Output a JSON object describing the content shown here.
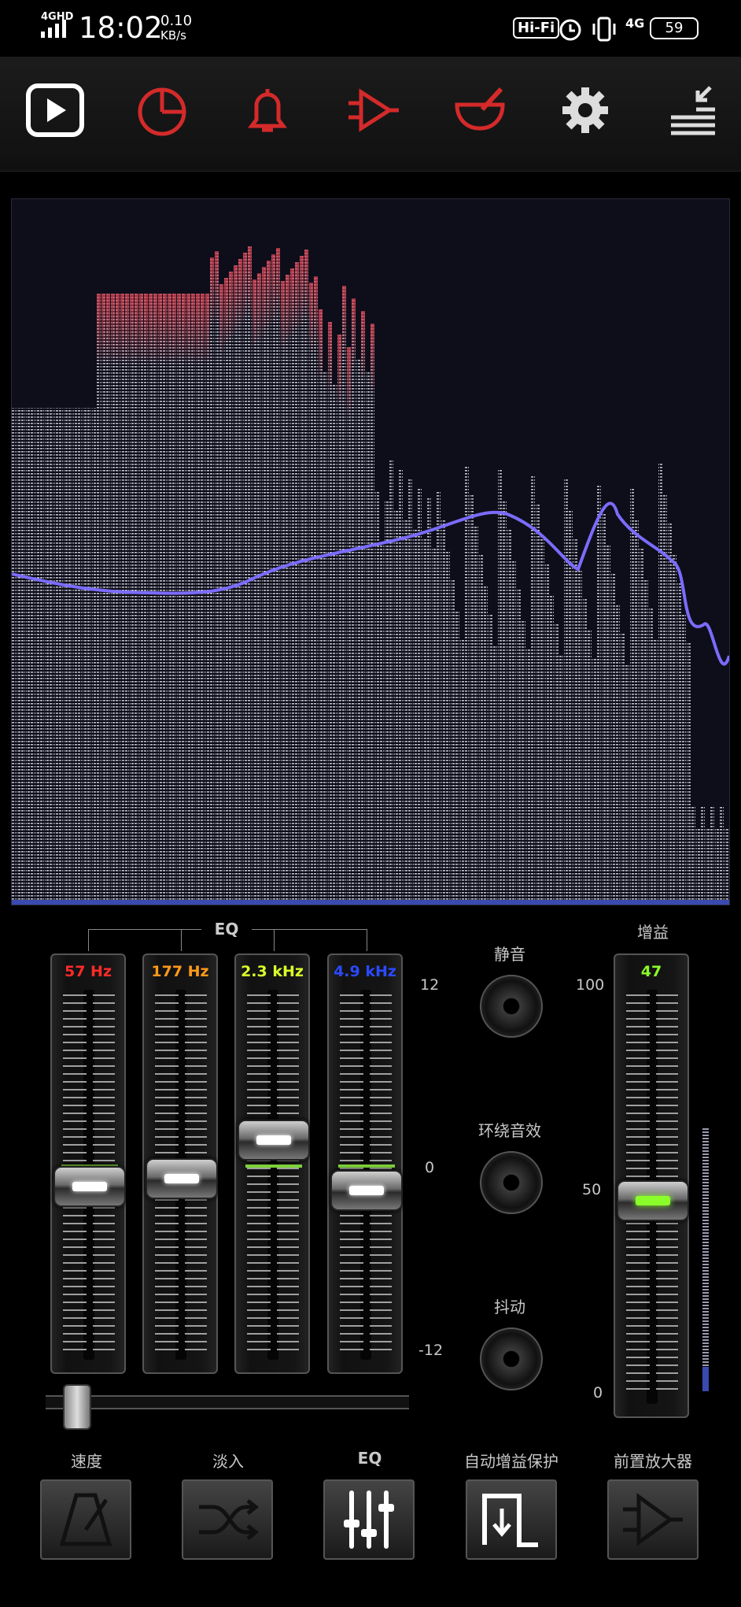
{
  "status": {
    "network_type": "4GHD",
    "time": "18:02",
    "speed_value": "0.10",
    "speed_unit": "KB/s",
    "hifi": "Hi-Fi",
    "cell": "4G",
    "battery": "59"
  },
  "toolbar": {
    "icons": [
      "play-icon",
      "pie-chart-icon",
      "bell-icon",
      "amplifier-icon",
      "mortar-icon",
      "gear-icon",
      "collapse-menu-icon"
    ]
  },
  "eq": {
    "header": "EQ",
    "bands": [
      {
        "freq": "57 Hz",
        "color": "#ff2a2a",
        "gain_db": -1.5
      },
      {
        "freq": "177 Hz",
        "color": "#ff9a1a",
        "gain_db": -1.0
      },
      {
        "freq": "2.3 kHz",
        "color": "#d8ff2a",
        "gain_db": 1.7
      },
      {
        "freq": "4.9 kHz",
        "color": "#2a4aff",
        "gain_db": -1.8
      }
    ],
    "scale_top": "12",
    "scale_mid": "0",
    "scale_bottom": "-12"
  },
  "toggles": {
    "mute": "静音",
    "surround": "环绕音效",
    "dither": "抖动"
  },
  "gain": {
    "label": "增益",
    "value": "47",
    "scale_top": "100",
    "scale_mid": "50",
    "scale_bottom": "0"
  },
  "bottom": {
    "tempo": "速度",
    "fade": "淡入",
    "eq": "EQ",
    "agc": "自动增益保护",
    "preamp": "前置放大器"
  }
}
